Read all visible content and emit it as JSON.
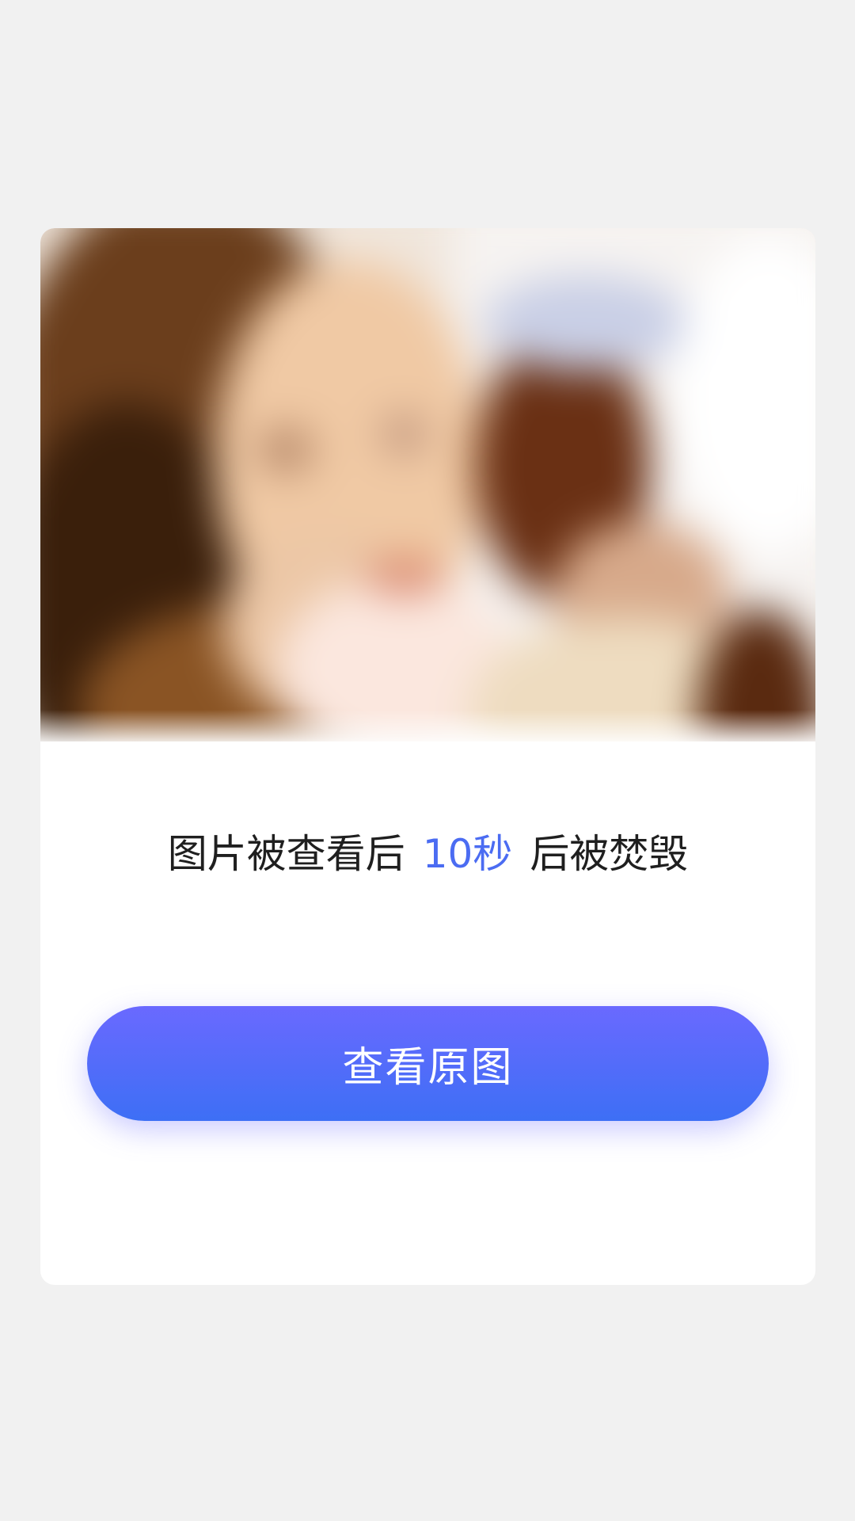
{
  "notice": {
    "before": "图片被查看后",
    "countdown": "10秒",
    "after": "后被焚毁"
  },
  "button": {
    "label": "查看原图"
  },
  "colors": {
    "page_background": "#f1f1f1",
    "card_background": "#ffffff",
    "countdown_accent": "#4b6cf2",
    "button_gradient_top": "#6a69ff",
    "button_gradient_bottom": "#3d6ff5"
  }
}
